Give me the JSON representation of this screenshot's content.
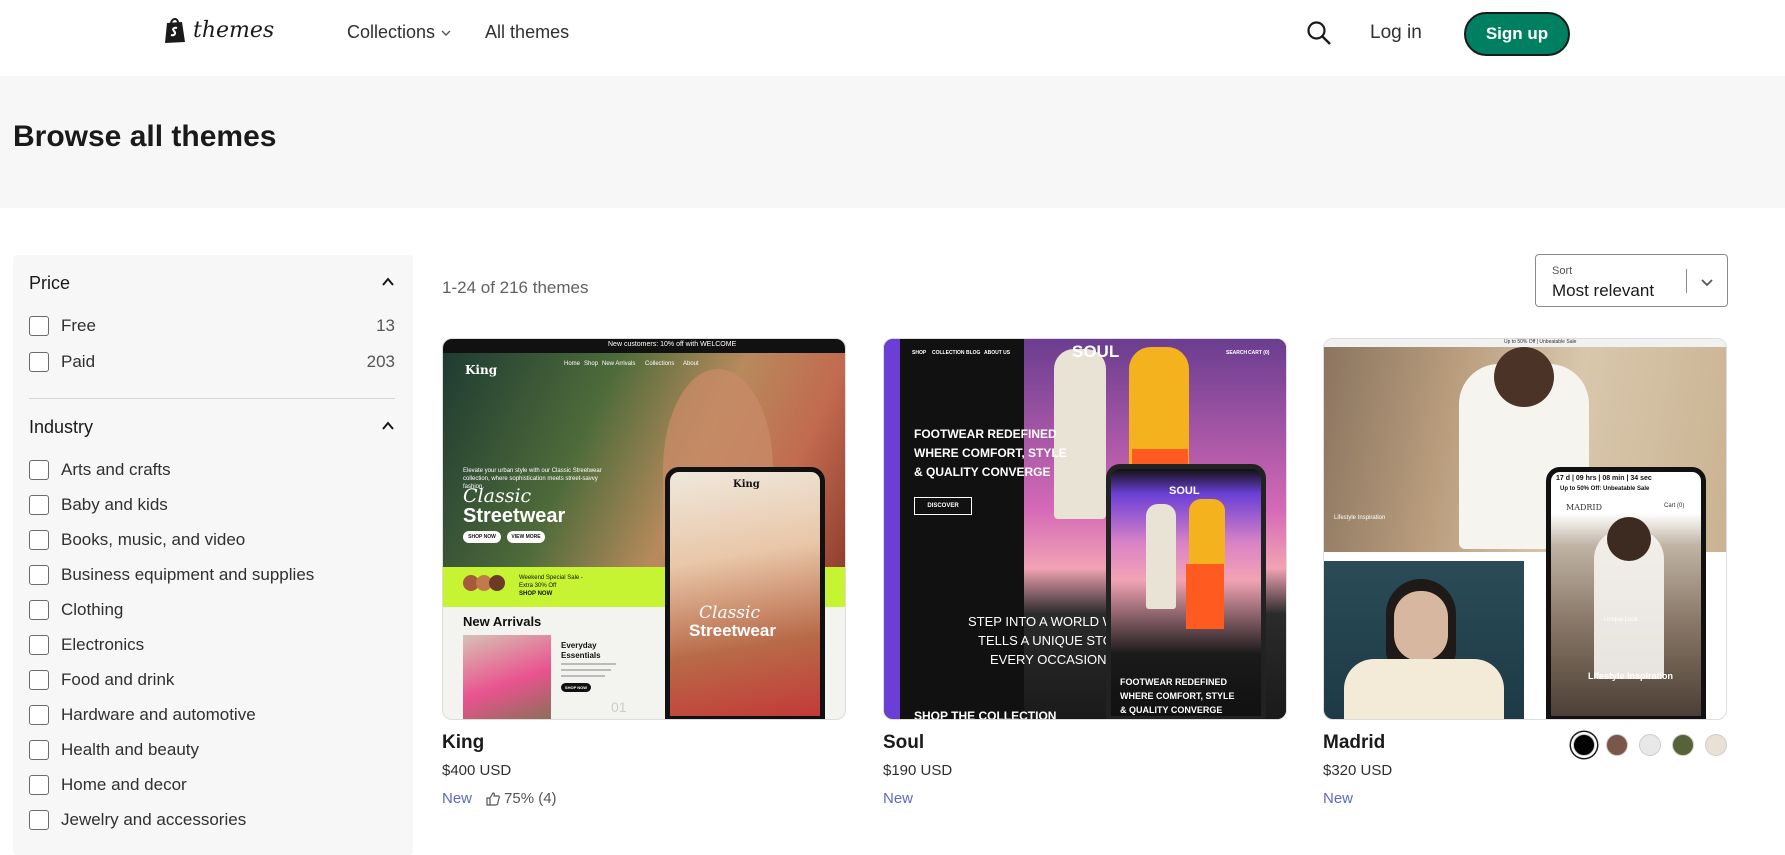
{
  "header": {
    "logo_text": "themes",
    "nav": [
      {
        "label": "Collections",
        "has_caret": true
      },
      {
        "label": "All themes"
      }
    ],
    "login": "Log in",
    "signup": "Sign up"
  },
  "hero": {
    "title": "Browse all themes"
  },
  "filters": {
    "price": {
      "title": "Price",
      "options": [
        {
          "label": "Free",
          "count": "13"
        },
        {
          "label": "Paid",
          "count": "203"
        }
      ]
    },
    "industry": {
      "title": "Industry",
      "options": [
        {
          "label": "Arts and crafts"
        },
        {
          "label": "Baby and kids"
        },
        {
          "label": "Books, music, and video"
        },
        {
          "label": "Business equipment and supplies"
        },
        {
          "label": "Clothing"
        },
        {
          "label": "Electronics"
        },
        {
          "label": "Food and drink"
        },
        {
          "label": "Hardware and automotive"
        },
        {
          "label": "Health and beauty"
        },
        {
          "label": "Home and decor"
        },
        {
          "label": "Jewelry and accessories"
        }
      ]
    }
  },
  "results": {
    "count_text": "1-24 of 216 themes"
  },
  "sort": {
    "label": "Sort",
    "value": "Most relevant"
  },
  "themes": [
    {
      "name": "King",
      "price": "$400 USD",
      "badge": "New",
      "rating": "75% (4)",
      "preview": {
        "topbar": "New customers: 10% off with WELCOME",
        "brand": "King",
        "menu": [
          "Home",
          "Shop",
          "New Arrivals",
          "Collections",
          "About"
        ],
        "tagline": "Elevate your urban style with our Classic Streetwear collection, where sophistication meets street-savvy fashion.",
        "headline_1": "Classic",
        "headline_2": "Streetwear",
        "btn_1": "SHOP NOW",
        "btn_2": "VIEW MORE",
        "promo_1": "Weekend Special Sale -",
        "promo_2": "Extra 30% Off",
        "promo_cta": "SHOP NOW",
        "section": "New Arrivals",
        "card_title_1": "Everyday",
        "card_title_2": "Essentials",
        "card_btn": "SHOP NOW",
        "page_num": "01"
      }
    },
    {
      "name": "Soul",
      "price": "$190 USD",
      "badge": "New",
      "preview": {
        "brand": "SOUL",
        "menu": [
          "SHOP",
          "COLLECTION",
          "BLOG",
          "ABOUT US"
        ],
        "menu_right": [
          "SEARCH",
          "CART (0)"
        ],
        "headline_1": "FOOTWEAR REDEFINED",
        "headline_2": "WHERE COMFORT, STYLE",
        "headline_3": "& QUALITY CONVERGE",
        "cta": "DISCOVER",
        "story_1": "STEP INTO A WORLD W",
        "story_2": "TELLS A UNIQUE STO",
        "story_3": "EVERY OCCASION A",
        "bottom": "SHOP THE COLLECTION"
      }
    },
    {
      "name": "Madrid",
      "price": "$320 USD",
      "badge": "New",
      "swatches": [
        "#000000",
        "#7a5748",
        "#e8e8e8",
        "#566338",
        "#e9e1d4"
      ],
      "preview": {
        "topbar": "Up to 50% Off | Unbeatable Sale",
        "brand": "MADRID",
        "label_1": "Lifestyle Inspiration",
        "countdown": "17 d | 09 hrs | 08 min | 34 sec",
        "countdown_sub": "Up to 50% Off: Unbeatable Sale",
        "cart": "Cart (0)",
        "unique": "Unique Look",
        "label_2": "Lifestyle Inspiration"
      }
    }
  ]
}
